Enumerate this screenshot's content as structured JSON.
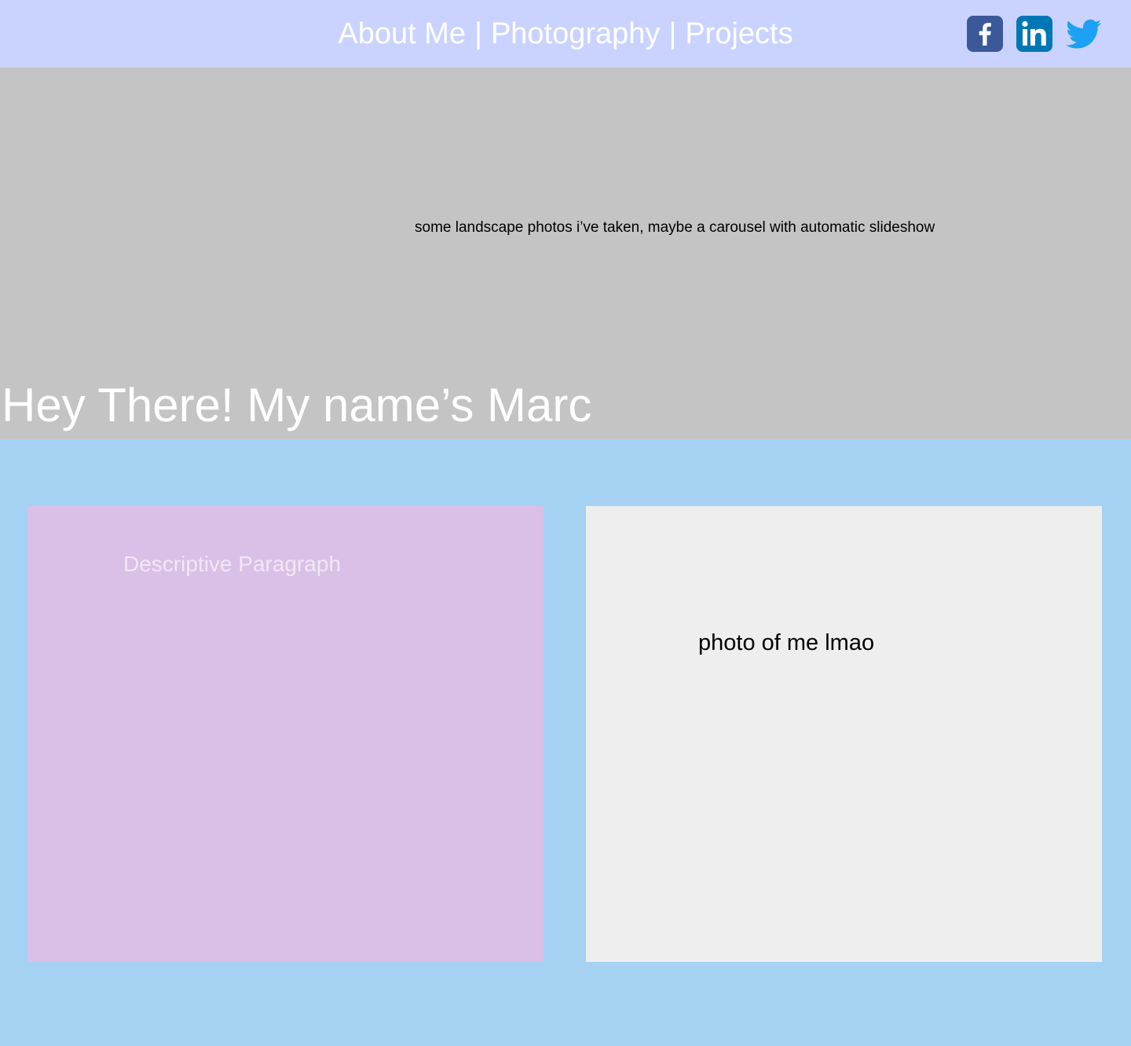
{
  "nav": {
    "items": [
      {
        "label": "About Me"
      },
      {
        "label": "Photography"
      },
      {
        "label": "Projects"
      }
    ],
    "separator": "|"
  },
  "social": [
    {
      "icon": "facebook-icon",
      "color": "#3b5998"
    },
    {
      "icon": "linkedin-icon",
      "color": "#0077b5"
    },
    {
      "icon": "twitter-icon",
      "color": "#1da1f2"
    }
  ],
  "hero": {
    "caption": "some landscape photos i’ve taken, maybe a carousel with automatic slideshow",
    "title": "Hey There! My name’s Marc"
  },
  "content": {
    "left_label": "Descriptive Paragraph",
    "right_label": "photo of me lmao"
  },
  "colors": {
    "header_bg": "#cad3ff",
    "hero_bg": "#c4c4c4",
    "page_bg": "#a5d2f3",
    "left_card_bg": "#d9c0e6",
    "right_card_bg": "#eeeeee"
  }
}
